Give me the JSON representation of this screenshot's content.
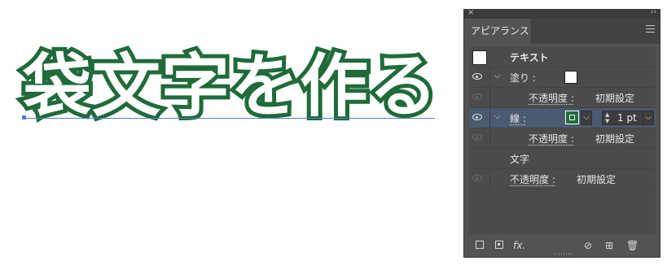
{
  "artboard": {
    "text": "袋文字を作る",
    "stroke_color": "#1f6b3a",
    "fill_color": "#ffffff"
  },
  "panel": {
    "close_glyph": "×",
    "collapse_glyph": "‹‹",
    "tab_label": "アピアランス",
    "rows": {
      "text_object": "テキスト",
      "fill_label": "塗り :",
      "fill_opacity_label": "不透明度 :",
      "fill_opacity_value": "初期設定",
      "stroke_label": "線 :",
      "stroke_weight": "1 pt",
      "stroke_opacity_label": "不透明度 :",
      "stroke_opacity_value": "初期設定",
      "characters_label": "文字",
      "char_opacity_label": "不透明度 :",
      "char_opacity_value": "初期設定"
    },
    "bottom": {
      "fx_label": "fx."
    },
    "colors": {
      "panel_bg": "#535353",
      "selected_row": "#4a5a70",
      "stroke_swatch": "#1f6b3a"
    }
  }
}
